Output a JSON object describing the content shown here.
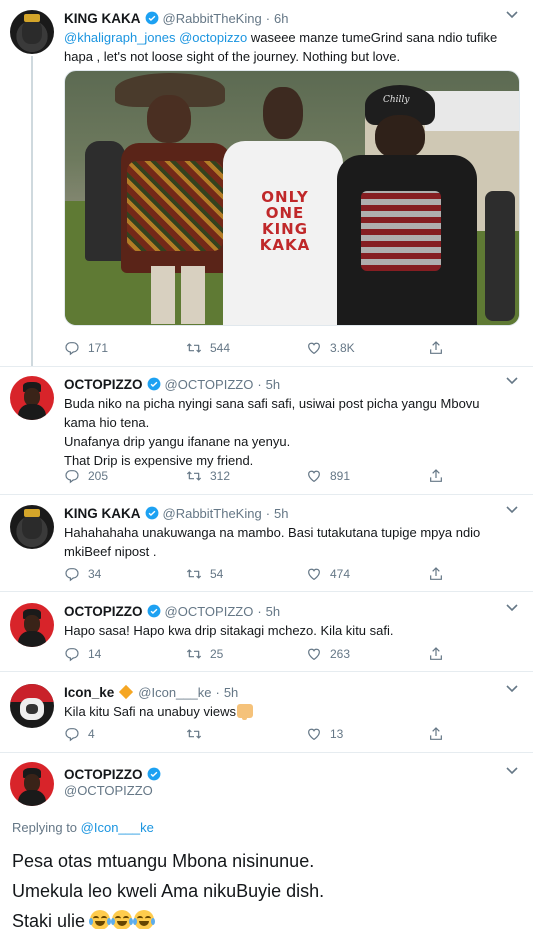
{
  "colors": {
    "link": "#1b95e0",
    "verified": "#1da1f2",
    "meta": "#657786",
    "text": "#14171a"
  },
  "tweets": [
    {
      "name": "KING KAKA",
      "handle": "@RabbitTheKing",
      "dot": "·",
      "time": "6h",
      "verified": true,
      "text_parts": [
        "@khaligraph_jones ",
        " @octopizzo",
        " waseee manze tumeGrind sana ndio tufike hapa , let's not loose sight of the journey. Nothing but love."
      ],
      "photo_shirt_text": [
        "ONLY",
        "ONE",
        "KING",
        "KAKA"
      ],
      "cap_text": "Chilly",
      "replies": "171",
      "retweets": "544",
      "likes": "3.8K"
    },
    {
      "name": "OCTOPIZZO",
      "handle": "@OCTOPIZZO",
      "dot": "·",
      "time": "5h",
      "verified": true,
      "lines": [
        "Buda niko na picha nyingi sana safi safi, usiwai post picha yangu Mbovu kama hio tena.",
        "Unafanya drip yangu ifanane na yenyu.",
        "That Drip is expensive my friend."
      ],
      "replies": "205",
      "retweets": "312",
      "likes": "891"
    },
    {
      "name": "KING KAKA",
      "handle": "@RabbitTheKing",
      "dot": "·",
      "time": "5h",
      "verified": true,
      "text": "Hahahahaha unakuwanga na mambo. Basi tutakutana tupige mpya ndio mkiBeef nipost .",
      "replies": "34",
      "retweets": "54",
      "likes": "474"
    },
    {
      "name": "OCTOPIZZO",
      "handle": "@OCTOPIZZO",
      "dot": "·",
      "time": "5h",
      "verified": true,
      "text": "Hapo sasa! Hapo kwa drip sitakagi mchezo. Kila kitu safi.",
      "replies": "14",
      "retweets": "25",
      "likes": "263"
    },
    {
      "name": "Icon_ke",
      "handle": "@Icon___ke",
      "dot": "·",
      "time": "5h",
      "verified": false,
      "text": "Kila kitu Safi na unabuy views",
      "replies": "4",
      "retweets": "",
      "likes": "13"
    }
  ],
  "main_tweet": {
    "name": "OCTOPIZZO",
    "handle": "@OCTOPIZZO",
    "replying_prefix": "Replying to ",
    "replying_to": "@Icon___ke",
    "lines": [
      "Pesa otas mtuangu Mbona nisinunue.",
      "Umekula leo kweli Ama nikuBuyie dish.",
      "Staki ulie "
    ]
  },
  "icons": [
    "reply-icon",
    "retweet-icon",
    "like-icon",
    "share-icon",
    "verified-icon",
    "chevron-down-icon"
  ]
}
